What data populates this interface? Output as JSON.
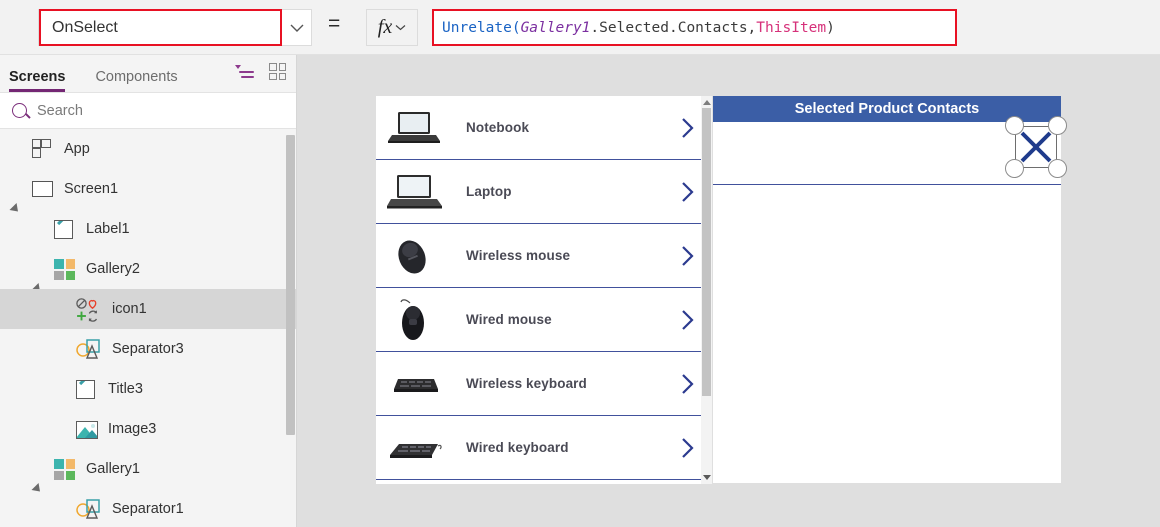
{
  "formula_bar": {
    "property_value": "OnSelect",
    "property_caret_icon": "chevron-down-icon",
    "equals_sign": "=",
    "fx_glyph": "fx",
    "fx_caret_icon": "chevron-down-icon",
    "formula_tokens": [
      {
        "text": "Unrelate(",
        "kind": "function",
        "color": "#1a63c4"
      },
      {
        "text": " Gallery1",
        "kind": "control",
        "color": "#7b2fa0"
      },
      {
        "text": ".Selected.Contacts,",
        "kind": "plain",
        "color": "#3b3b3b"
      },
      {
        "text": " ThisItem",
        "kind": "this",
        "color": "#d6317a"
      },
      {
        "text": " )",
        "kind": "paren",
        "color": "#3b3b3b"
      }
    ],
    "formula_plain": "Unrelate( Gallery1.Selected.Contacts, ThisItem )",
    "highlight_color": "#e81123"
  },
  "tree_panel": {
    "tabs": [
      {
        "label": "Screens",
        "active": true
      },
      {
        "label": "Components",
        "active": false
      }
    ],
    "toolbar_icons": [
      {
        "name": "filter-list-icon",
        "color": "#8d3a8d"
      },
      {
        "name": "thumbnail-grid-icon",
        "color": "#8a8a8a"
      }
    ],
    "search": {
      "placeholder": "Search",
      "value": "",
      "icon": "search-icon"
    },
    "items": [
      {
        "label": "App",
        "icon": "app-icon",
        "indent": 0,
        "expander": "none",
        "selected": false
      },
      {
        "label": "Screen1",
        "icon": "screen-icon",
        "indent": 0,
        "expander": "expanded",
        "selected": false
      },
      {
        "label": "Label1",
        "icon": "label-icon",
        "indent": 1,
        "expander": "none",
        "selected": false
      },
      {
        "label": "Gallery2",
        "icon": "gallery-icon",
        "indent": 1,
        "expander": "expanded",
        "selected": false
      },
      {
        "label": "icon1",
        "icon": "icons-icon",
        "indent": 2,
        "expander": "none",
        "selected": true
      },
      {
        "label": "Separator3",
        "icon": "separator-icon",
        "indent": 2,
        "expander": "none",
        "selected": false
      },
      {
        "label": "Title3",
        "icon": "label-icon",
        "indent": 2,
        "expander": "none",
        "selected": false
      },
      {
        "label": "Image3",
        "icon": "image-icon",
        "indent": 2,
        "expander": "none",
        "selected": false
      },
      {
        "label": "Gallery1",
        "icon": "gallery-icon",
        "indent": 1,
        "expander": "expanded",
        "selected": false
      },
      {
        "label": "Separator1",
        "icon": "separator-icon",
        "indent": 2,
        "expander": "none",
        "selected": false
      }
    ]
  },
  "canvas": {
    "background_color": "#dfdfdf",
    "gallery": {
      "name": "product-gallery",
      "separator_color": "#41519c",
      "chevron_icon": "chevron-right-icon",
      "chevron_color": "#2b3a8f",
      "items": [
        {
          "title": "Notebook",
          "thumb": "notebook-image"
        },
        {
          "title": "Laptop",
          "thumb": "laptop-image"
        },
        {
          "title": "Wireless mouse",
          "thumb": "wireless-mouse-image"
        },
        {
          "title": "Wired mouse",
          "thumb": "wired-mouse-image"
        },
        {
          "title": "Wireless keyboard",
          "thumb": "wireless-keyboard-image"
        },
        {
          "title": "Wired keyboard",
          "thumb": "wired-keyboard-image"
        }
      ]
    },
    "contacts_panel": {
      "header_title": "Selected Product Contacts",
      "header_color": "#3b5ea6",
      "separator_color": "#41519c",
      "selected_control": {
        "name": "icon1",
        "icon": "cancel-x-icon",
        "icon_color": "#1f3b8c",
        "handle_count": 4
      }
    }
  }
}
